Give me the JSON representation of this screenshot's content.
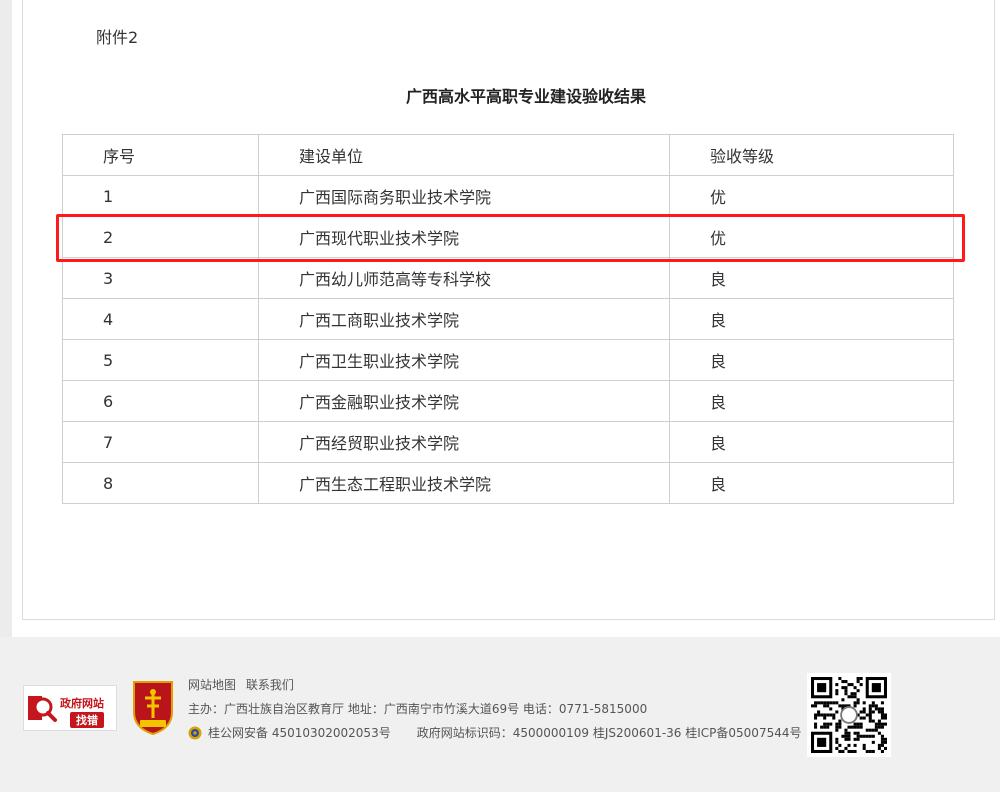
{
  "attachment_label": "附件2",
  "title": "广西高水平高职专业建设验收结果",
  "table": {
    "headers": [
      "序号",
      "建设单位",
      "验收等级"
    ],
    "rows": [
      {
        "no": "1",
        "unit": "广西国际商务职业技术学院",
        "grade": "优"
      },
      {
        "no": "2",
        "unit": "广西现代职业技术学院",
        "grade": "优"
      },
      {
        "no": "3",
        "unit": "广西幼儿师范高等专科学校",
        "grade": "良"
      },
      {
        "no": "4",
        "unit": "广西工商职业技术学院",
        "grade": "良"
      },
      {
        "no": "5",
        "unit": "广西卫生职业技术学院",
        "grade": "良"
      },
      {
        "no": "6",
        "unit": "广西金融职业技术学院",
        "grade": "良"
      },
      {
        "no": "7",
        "unit": "广西经贸职业技术学院",
        "grade": "良"
      },
      {
        "no": "8",
        "unit": "广西生态工程职业技术学院",
        "grade": "良"
      }
    ]
  },
  "footer": {
    "badge_line1": "政府网站",
    "badge_line2": "找错",
    "links": [
      "网站地图",
      "联系我们"
    ],
    "host_line": "主办：广西壮族自治区教育厅 地址：广西南宁市竹溪大道69号 电话：0771-5815000",
    "police_reg": "桂公网安备 45010302002053号",
    "site_id": "政府网站标识码：4500000109 桂JS200601-36 桂ICP备05007544号"
  },
  "colors": {
    "highlight": "#ff1a1a",
    "brand_red": "#c4161c",
    "footer_bg": "#f0f0f0"
  }
}
